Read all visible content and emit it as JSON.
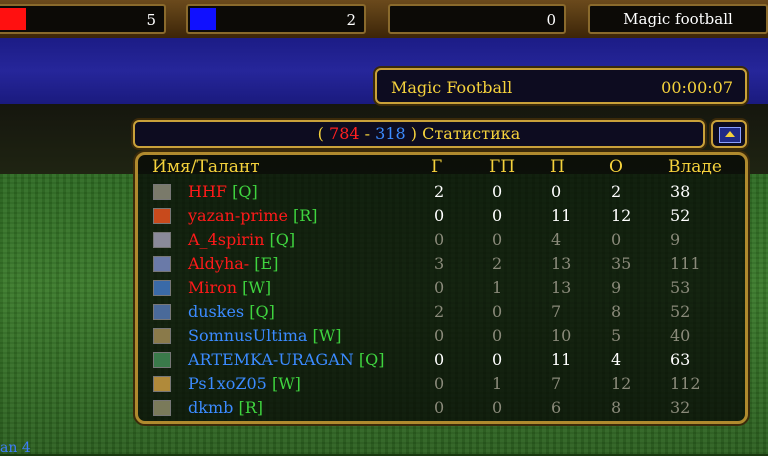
{
  "topbar": {
    "slots": [
      {
        "color": "#ff1010",
        "value": "5"
      },
      {
        "color": "#1010ff",
        "value": "2"
      },
      {
        "color": "",
        "value": "0"
      }
    ],
    "title": "Magic football"
  },
  "info": {
    "game_name": "Magic Football",
    "time": "00:00:07"
  },
  "stats": {
    "open": "(",
    "score_red": "784",
    "sep": "-",
    "score_blue": "318",
    "close": ")",
    "label": "Статистика",
    "score_red_color": "#ff2020",
    "score_blue_color": "#3b8bff"
  },
  "columns": [
    "Имя/Талант",
    "Г",
    "ГП",
    "П",
    "О",
    "Владе"
  ],
  "players": [
    {
      "name": "HHF",
      "talent": "[Q]",
      "team": "red",
      "g": "2",
      "gp": "0",
      "p": "0",
      "o": "2",
      "v": "38",
      "active": true,
      "avatar_color": "#7a7a6a"
    },
    {
      "name": "yazan-prime",
      "talent": "[R]",
      "team": "red",
      "g": "0",
      "gp": "0",
      "p": "11",
      "o": "12",
      "v": "52",
      "active": true,
      "avatar_color": "#c84a1c"
    },
    {
      "name": "A_4spirin",
      "talent": "[Q]",
      "team": "red",
      "g": "0",
      "gp": "0",
      "p": "4",
      "o": "0",
      "v": "9",
      "active": false,
      "avatar_color": "#8a8a9a"
    },
    {
      "name": "Aldyha-",
      "talent": "[E]",
      "team": "red",
      "g": "3",
      "gp": "2",
      "p": "13",
      "o": "35",
      "v": "111",
      "active": false,
      "avatar_color": "#6a7aa8"
    },
    {
      "name": "Miron",
      "talent": "[W]",
      "team": "red",
      "g": "0",
      "gp": "1",
      "p": "13",
      "o": "9",
      "v": "53",
      "active": false,
      "avatar_color": "#3a6aa8"
    },
    {
      "name": "duskes",
      "talent": "[Q]",
      "team": "blue",
      "g": "2",
      "gp": "0",
      "p": "7",
      "o": "8",
      "v": "52",
      "active": false,
      "avatar_color": "#4a6a9a"
    },
    {
      "name": "SomnusUltima",
      "talent": "[W]",
      "team": "blue",
      "g": "0",
      "gp": "0",
      "p": "10",
      "o": "5",
      "v": "40",
      "active": false,
      "avatar_color": "#8a7a4a"
    },
    {
      "name": "ARTEMKA-URAGAN",
      "talent": "[Q]",
      "team": "blue",
      "g": "0",
      "gp": "0",
      "p": "11",
      "o": "4",
      "v": "63",
      "active": true,
      "avatar_color": "#3a7a4a"
    },
    {
      "name": "Ps1xoZ05",
      "talent": "[W]",
      "team": "blue",
      "g": "0",
      "gp": "1",
      "p": "7",
      "o": "12",
      "v": "112",
      "active": false,
      "avatar_color": "#b08a3a"
    },
    {
      "name": "dkmb",
      "talent": "[R]",
      "team": "blue",
      "g": "0",
      "gp": "0",
      "p": "6",
      "o": "8",
      "v": "32",
      "active": false,
      "avatar_color": "#7a7a5a"
    }
  ],
  "team_colors": {
    "red": "#ff1a1a",
    "blue": "#3b8bff"
  },
  "bottom_text": "an 4"
}
